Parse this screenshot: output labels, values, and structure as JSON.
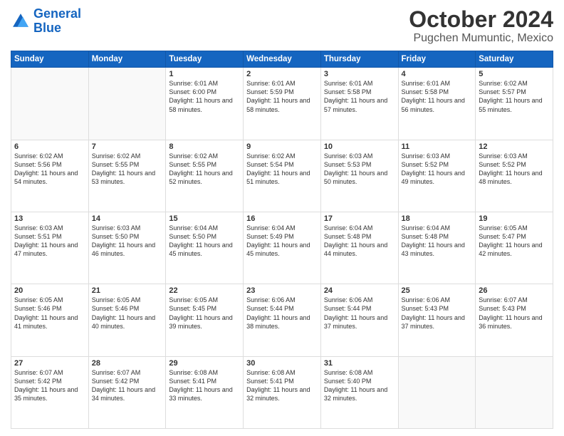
{
  "header": {
    "logo_line1": "General",
    "logo_line2": "Blue",
    "month": "October 2024",
    "location": "Pugchen Mumuntic, Mexico"
  },
  "weekdays": [
    "Sunday",
    "Monday",
    "Tuesday",
    "Wednesday",
    "Thursday",
    "Friday",
    "Saturday"
  ],
  "weeks": [
    [
      {
        "day": "",
        "text": ""
      },
      {
        "day": "",
        "text": ""
      },
      {
        "day": "1",
        "text": "Sunrise: 6:01 AM\nSunset: 6:00 PM\nDaylight: 11 hours and 58 minutes."
      },
      {
        "day": "2",
        "text": "Sunrise: 6:01 AM\nSunset: 5:59 PM\nDaylight: 11 hours and 58 minutes."
      },
      {
        "day": "3",
        "text": "Sunrise: 6:01 AM\nSunset: 5:58 PM\nDaylight: 11 hours and 57 minutes."
      },
      {
        "day": "4",
        "text": "Sunrise: 6:01 AM\nSunset: 5:58 PM\nDaylight: 11 hours and 56 minutes."
      },
      {
        "day": "5",
        "text": "Sunrise: 6:02 AM\nSunset: 5:57 PM\nDaylight: 11 hours and 55 minutes."
      }
    ],
    [
      {
        "day": "6",
        "text": "Sunrise: 6:02 AM\nSunset: 5:56 PM\nDaylight: 11 hours and 54 minutes."
      },
      {
        "day": "7",
        "text": "Sunrise: 6:02 AM\nSunset: 5:55 PM\nDaylight: 11 hours and 53 minutes."
      },
      {
        "day": "8",
        "text": "Sunrise: 6:02 AM\nSunset: 5:55 PM\nDaylight: 11 hours and 52 minutes."
      },
      {
        "day": "9",
        "text": "Sunrise: 6:02 AM\nSunset: 5:54 PM\nDaylight: 11 hours and 51 minutes."
      },
      {
        "day": "10",
        "text": "Sunrise: 6:03 AM\nSunset: 5:53 PM\nDaylight: 11 hours and 50 minutes."
      },
      {
        "day": "11",
        "text": "Sunrise: 6:03 AM\nSunset: 5:52 PM\nDaylight: 11 hours and 49 minutes."
      },
      {
        "day": "12",
        "text": "Sunrise: 6:03 AM\nSunset: 5:52 PM\nDaylight: 11 hours and 48 minutes."
      }
    ],
    [
      {
        "day": "13",
        "text": "Sunrise: 6:03 AM\nSunset: 5:51 PM\nDaylight: 11 hours and 47 minutes."
      },
      {
        "day": "14",
        "text": "Sunrise: 6:03 AM\nSunset: 5:50 PM\nDaylight: 11 hours and 46 minutes."
      },
      {
        "day": "15",
        "text": "Sunrise: 6:04 AM\nSunset: 5:50 PM\nDaylight: 11 hours and 45 minutes."
      },
      {
        "day": "16",
        "text": "Sunrise: 6:04 AM\nSunset: 5:49 PM\nDaylight: 11 hours and 45 minutes."
      },
      {
        "day": "17",
        "text": "Sunrise: 6:04 AM\nSunset: 5:48 PM\nDaylight: 11 hours and 44 minutes."
      },
      {
        "day": "18",
        "text": "Sunrise: 6:04 AM\nSunset: 5:48 PM\nDaylight: 11 hours and 43 minutes."
      },
      {
        "day": "19",
        "text": "Sunrise: 6:05 AM\nSunset: 5:47 PM\nDaylight: 11 hours and 42 minutes."
      }
    ],
    [
      {
        "day": "20",
        "text": "Sunrise: 6:05 AM\nSunset: 5:46 PM\nDaylight: 11 hours and 41 minutes."
      },
      {
        "day": "21",
        "text": "Sunrise: 6:05 AM\nSunset: 5:46 PM\nDaylight: 11 hours and 40 minutes."
      },
      {
        "day": "22",
        "text": "Sunrise: 6:05 AM\nSunset: 5:45 PM\nDaylight: 11 hours and 39 minutes."
      },
      {
        "day": "23",
        "text": "Sunrise: 6:06 AM\nSunset: 5:44 PM\nDaylight: 11 hours and 38 minutes."
      },
      {
        "day": "24",
        "text": "Sunrise: 6:06 AM\nSunset: 5:44 PM\nDaylight: 11 hours and 37 minutes."
      },
      {
        "day": "25",
        "text": "Sunrise: 6:06 AM\nSunset: 5:43 PM\nDaylight: 11 hours and 37 minutes."
      },
      {
        "day": "26",
        "text": "Sunrise: 6:07 AM\nSunset: 5:43 PM\nDaylight: 11 hours and 36 minutes."
      }
    ],
    [
      {
        "day": "27",
        "text": "Sunrise: 6:07 AM\nSunset: 5:42 PM\nDaylight: 11 hours and 35 minutes."
      },
      {
        "day": "28",
        "text": "Sunrise: 6:07 AM\nSunset: 5:42 PM\nDaylight: 11 hours and 34 minutes."
      },
      {
        "day": "29",
        "text": "Sunrise: 6:08 AM\nSunset: 5:41 PM\nDaylight: 11 hours and 33 minutes."
      },
      {
        "day": "30",
        "text": "Sunrise: 6:08 AM\nSunset: 5:41 PM\nDaylight: 11 hours and 32 minutes."
      },
      {
        "day": "31",
        "text": "Sunrise: 6:08 AM\nSunset: 5:40 PM\nDaylight: 11 hours and 32 minutes."
      },
      {
        "day": "",
        "text": ""
      },
      {
        "day": "",
        "text": ""
      }
    ]
  ]
}
